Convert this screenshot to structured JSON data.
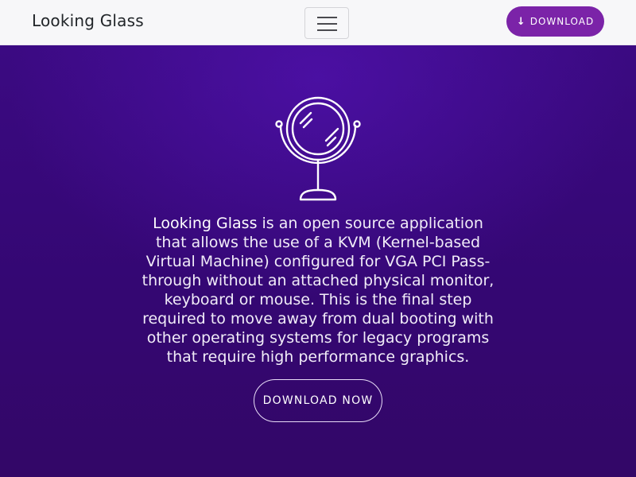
{
  "navbar": {
    "brand": "Looking Glass",
    "toggler_icon": "hamburger-menu-icon",
    "download_label": "DOWNLOAD",
    "download_icon": "arrow-down-icon",
    "download_color": "#7b23a8"
  },
  "hero": {
    "logo_icon": "mirror-icon",
    "intro_name": "Looking Glass",
    "intro_text": " is an open source application that allows the use of a KVM (Kernel-based Virtual Machine) configured for VGA PCI Pass-through without an attached physical monitor, keyboard or mouse. This is the final step required to move away from dual booting with other operating systems for legacy programs that require high performance graphics.",
    "download_now_label": "DOWNLOAD NOW",
    "background_color": "#3a0770"
  }
}
